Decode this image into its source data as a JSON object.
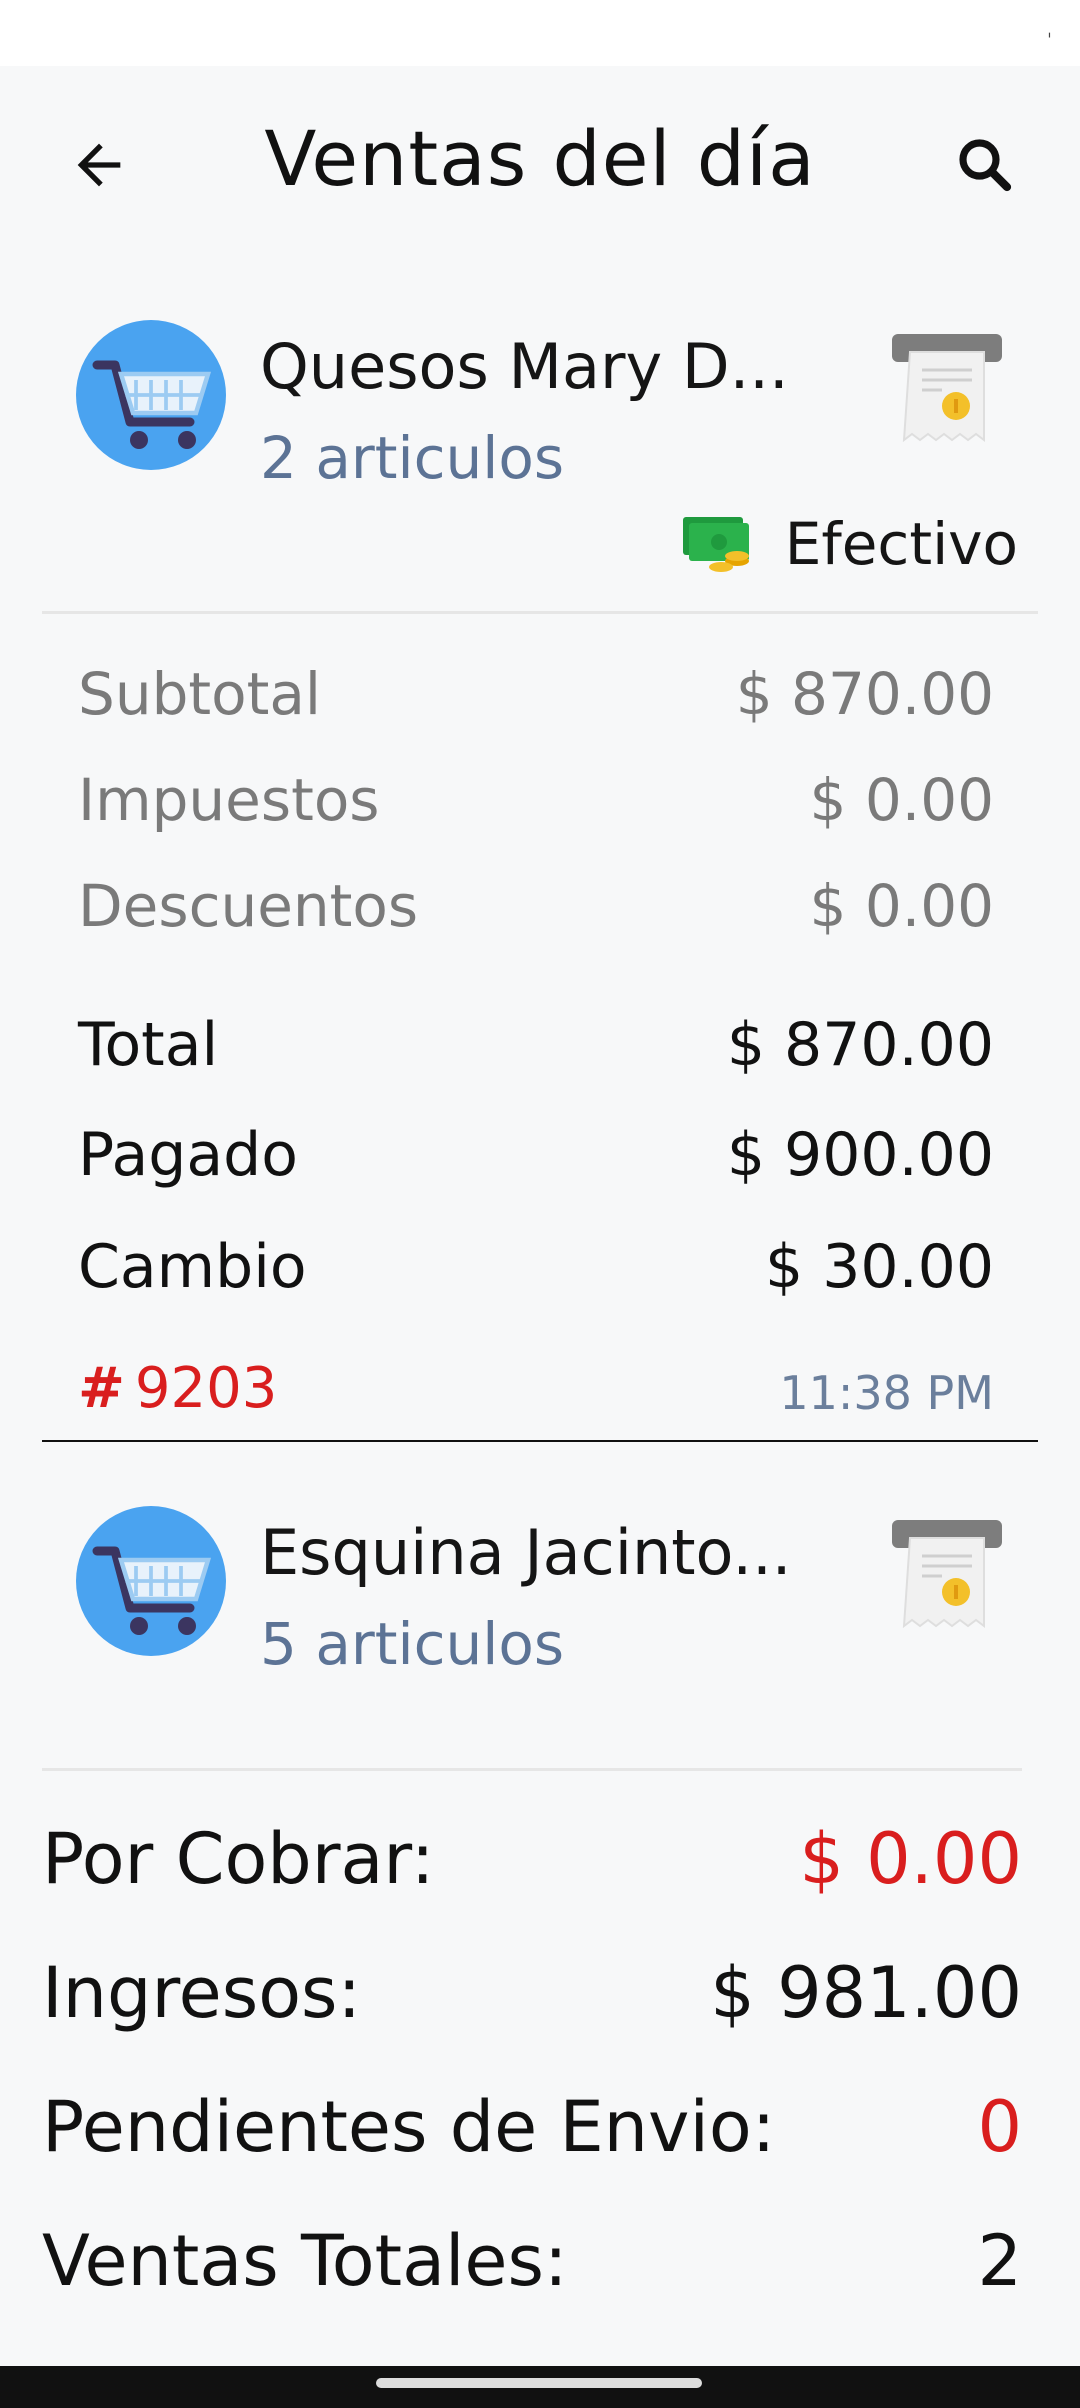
{
  "header": {
    "title": "Ventas del día"
  },
  "sales": [
    {
      "customer": "Quesos Mary D...",
      "items": "2 articulos",
      "payment_method": "Efectivo",
      "breakdown": {
        "subtotal_label": "Subtotal",
        "subtotal": "$ 870.00",
        "tax_label": "Impuestos",
        "tax": "$ 0.00",
        "discount_label": "Descuentos",
        "discount": "$ 0.00",
        "total_label": "Total",
        "total": "$ 870.00",
        "paid_label": "Pagado",
        "paid": "$ 900.00",
        "change_label": "Cambio",
        "change": "$ 30.00"
      },
      "order_hash": "#",
      "order_number": "9203",
      "time": "11:38 PM"
    },
    {
      "customer": "Esquina Jacinto...",
      "items": "5 articulos"
    }
  ],
  "summary": {
    "receivable_label": "Por Cobrar:",
    "receivable": "$ 0.00",
    "income_label": "Ingresos:",
    "income": "$ 981.00",
    "pending_label": "Pendientes de Envio:",
    "pending": "0",
    "total_sales_label": "Ventas Totales:",
    "total_sales": "2"
  },
  "icons": {
    "back": "arrow-left-icon",
    "search": "search-icon",
    "customer": "shopping-cart-icon",
    "receipt": "receipt-icon",
    "payment": "cash-icon"
  },
  "colors": {
    "accent_red": "#d91e1e",
    "secondary_text": "#5c7395",
    "cart_blue": "#4aa3f0",
    "cash_green": "#2bb24c"
  }
}
